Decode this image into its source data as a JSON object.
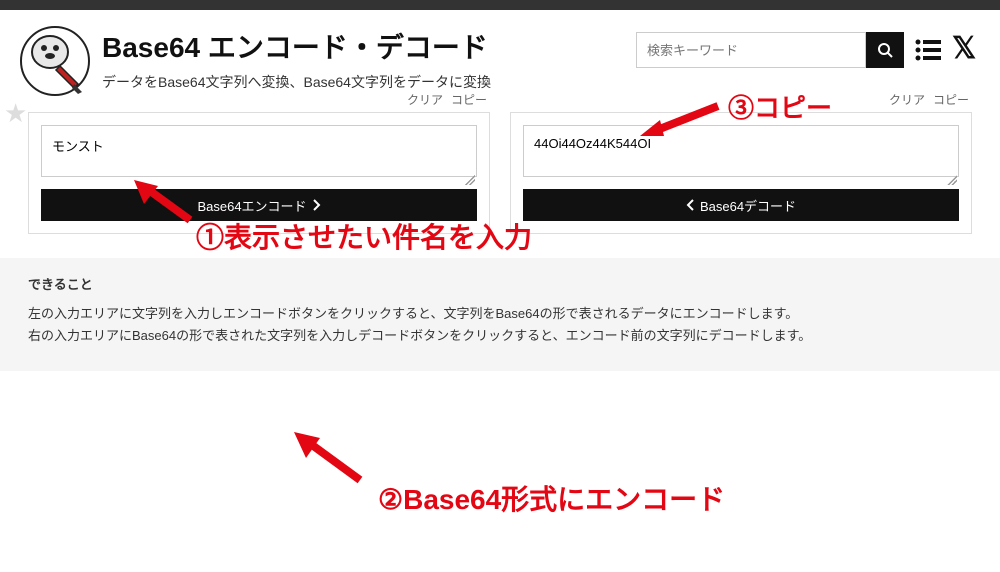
{
  "header": {
    "title": "Base64 エンコード・デコード",
    "subtitle": "データをBase64文字列へ変換、Base64文字列をデータに変換",
    "search_placeholder": "検索キーワード"
  },
  "panel_actions": {
    "clear": "クリア",
    "copy": "コピー"
  },
  "left_panel": {
    "value": "モンスト",
    "button_label": "Base64エンコード"
  },
  "right_panel": {
    "value": "44Oi44Oz44K544OI",
    "button_label": "Base64デコード"
  },
  "annotations": {
    "step1": "①表示させたい件名を入力",
    "step2": "②Base64形式にエンコード",
    "step3": "③コピー"
  },
  "footer": {
    "title": "できること",
    "line1": "左の入力エリアに文字列を入力しエンコードボタンをクリックすると、文字列をBase64の形で表されるデータにエンコードします。",
    "line2": "右の入力エリアにBase64の形で表された文字列を入力しデコードボタンをクリックすると、エンコード前の文字列にデコードします。"
  }
}
